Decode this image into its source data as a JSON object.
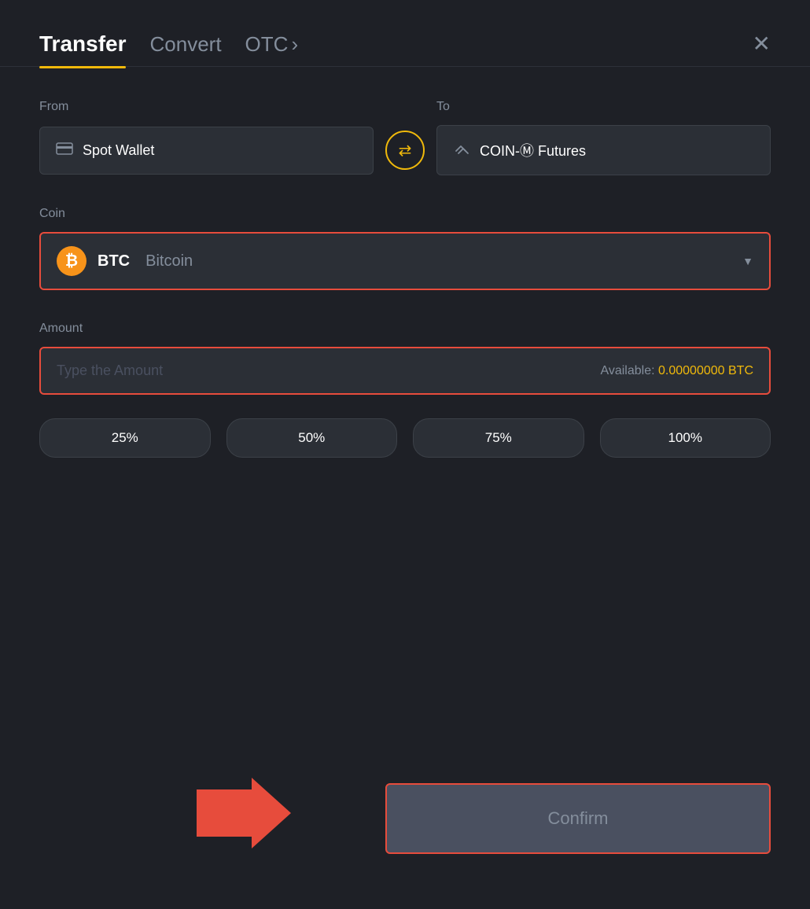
{
  "header": {
    "tab_transfer": "Transfer",
    "tab_convert": "Convert",
    "tab_otc": "OTC",
    "tab_otc_arrow": "›",
    "close_label": "✕"
  },
  "from_to": {
    "from_label": "From",
    "to_label": "To",
    "from_wallet": "Spot Wallet",
    "to_wallet": "COIN-Ⓜ Futures",
    "swap_icon": "⇄"
  },
  "coin": {
    "label": "Coin",
    "symbol": "BTC",
    "name": "Bitcoin",
    "btc_char": "₿"
  },
  "amount": {
    "label": "Amount",
    "placeholder": "Type the Amount",
    "available_label": "Available:",
    "available_value": "0.00000000 BTC"
  },
  "percent_buttons": [
    {
      "label": "25%"
    },
    {
      "label": "50%"
    },
    {
      "label": "75%"
    },
    {
      "label": "100%"
    }
  ],
  "confirm": {
    "label": "Confirm"
  }
}
